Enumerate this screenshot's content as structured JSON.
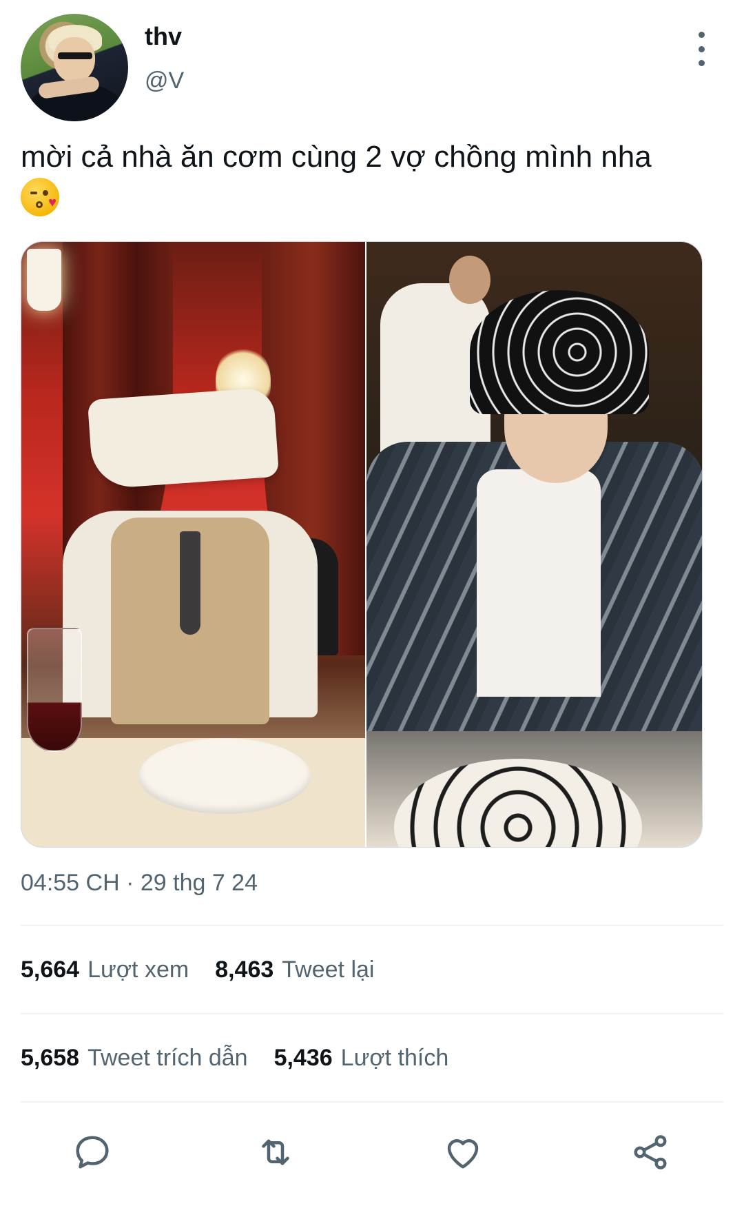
{
  "user": {
    "display_name": "thv",
    "handle": "@V"
  },
  "tweet": {
    "text": "mời cả nhà ăn cơm cùng 2 vợ chồng mình nha",
    "emoji": "face-blowing-a-kiss",
    "timestamp": "04:55 CH · 29 thg 7 24"
  },
  "stats": {
    "views": {
      "count": "5,664",
      "label": "Lượt xem"
    },
    "retweets": {
      "count": "8,463",
      "label": "Tweet lại"
    },
    "quotes": {
      "count": "5,658",
      "label": "Tweet trích dẫn"
    },
    "likes": {
      "count": "5,436",
      "label": "Lượt thích"
    }
  },
  "actions": {
    "icons": [
      "reply-icon",
      "retweet-icon",
      "like-icon",
      "share-icon"
    ]
  },
  "icons": {
    "more": "more-vertical-icon"
  },
  "colors": {
    "text_primary": "#0f1419",
    "text_secondary": "#536471",
    "divider": "#eff3f4"
  }
}
